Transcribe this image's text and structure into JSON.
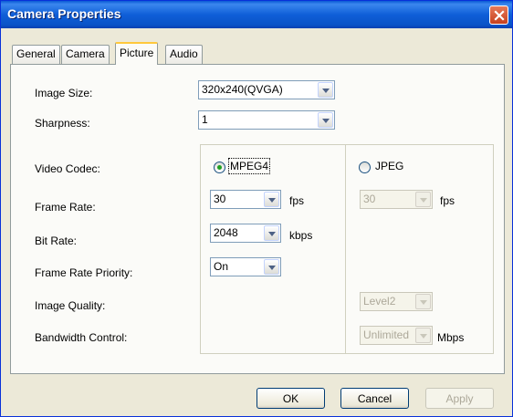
{
  "window": {
    "title": "Camera Properties"
  },
  "tabs": [
    {
      "label": "General"
    },
    {
      "label": "Camera"
    },
    {
      "label": "Picture"
    },
    {
      "label": "Audio"
    }
  ],
  "picture": {
    "image_size": {
      "label": "Image Size:",
      "value": "320x240(QVGA)"
    },
    "sharpness": {
      "label": "Sharpness:",
      "value": "1"
    },
    "video_codec": {
      "label": "Video Codec:",
      "options": [
        "MPEG4",
        "JPEG"
      ],
      "selected": "MPEG4"
    },
    "frame_rate": {
      "label": "Frame Rate:",
      "mpeg4_value": "30",
      "jpeg_value": "30",
      "unit": "fps"
    },
    "bit_rate": {
      "label": "Bit Rate:",
      "value": "2048",
      "unit": "kbps"
    },
    "frame_rate_priority": {
      "label": "Frame Rate Priority:",
      "value": "On"
    },
    "image_quality": {
      "label": "Image Quality:",
      "value": "Level2"
    },
    "bandwidth_control": {
      "label": "Bandwidth Control:",
      "value": "Unlimited",
      "unit": "Mbps"
    }
  },
  "buttons": {
    "ok": "OK",
    "cancel": "Cancel",
    "apply": "Apply"
  }
}
